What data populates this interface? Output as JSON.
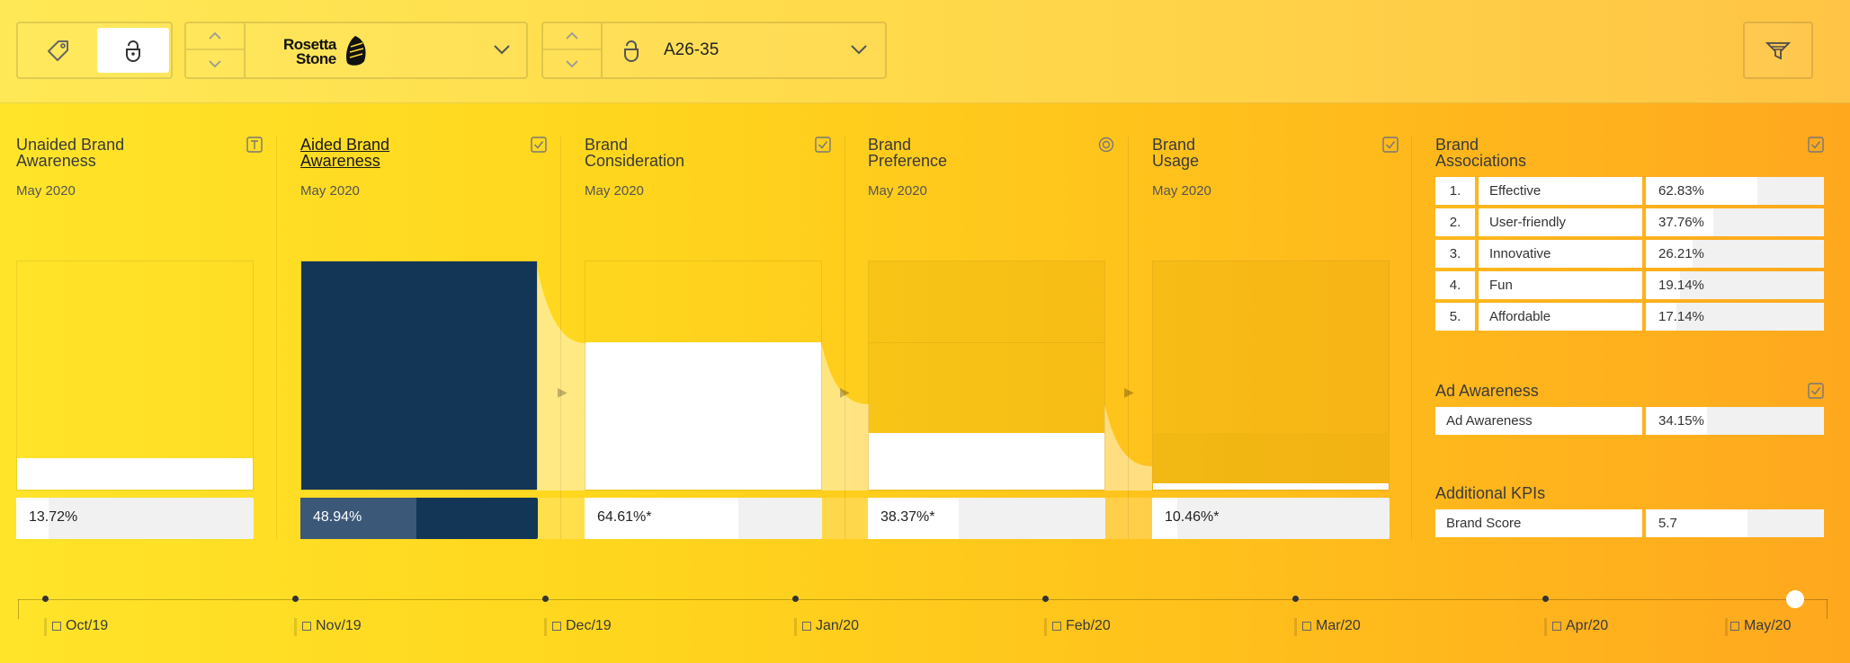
{
  "toolbar": {
    "brand": {
      "line1": "Rosetta",
      "line2": "Stone"
    },
    "age_group": "A26-35"
  },
  "kpis": [
    {
      "title_line1": "Unaided Brand",
      "title_line2": "Awareness",
      "date": "May 2020",
      "value": "13.72%",
      "pct": 13.72
    },
    {
      "title_line1": "Aided Brand",
      "title_line2": "Awareness",
      "date": "May 2020",
      "value": "48.94%",
      "pct": 48.94
    },
    {
      "title_line1": "Brand",
      "title_line2": "Consideration",
      "date": "May 2020",
      "value": "64.61%*",
      "pct": 64.61
    },
    {
      "title_line1": "Brand",
      "title_line2": "Preference",
      "date": "May 2020",
      "value": "38.37%*",
      "pct": 38.37
    },
    {
      "title_line1": "Brand",
      "title_line2": "Usage",
      "date": "May 2020",
      "value": "10.46%*",
      "pct": 10.46
    }
  ],
  "associations": {
    "title_line1": "Brand",
    "title_line2": "Associations",
    "items": [
      {
        "rank": "1.",
        "label": "Effective",
        "value": "62.83%",
        "pct": 62.83
      },
      {
        "rank": "2.",
        "label": "User-friendly",
        "value": "37.76%",
        "pct": 37.76
      },
      {
        "rank": "3.",
        "label": "Innovative",
        "value": "26.21%",
        "pct": 26.21
      },
      {
        "rank": "4.",
        "label": "Fun",
        "value": "19.14%",
        "pct": 19.14
      },
      {
        "rank": "5.",
        "label": "Affordable",
        "value": "17.14%",
        "pct": 17.14
      }
    ]
  },
  "ad_awareness": {
    "title": "Ad Awareness",
    "label": "Ad Awareness",
    "value": "34.15%",
    "pct": 34.15
  },
  "additional_kpis": {
    "title": "Additional KPIs",
    "label": "Brand Score",
    "value": "5.7",
    "pct": 57
  },
  "timeline": {
    "months": [
      "Oct/19",
      "Nov/19",
      "Dec/19",
      "Jan/20",
      "Feb/20",
      "Mar/20",
      "Apr/20",
      "May/20"
    ],
    "selected": "May/20"
  },
  "colors": {
    "accent_navy": "#133657",
    "background_start": "#ffe42a",
    "background_end": "#ffa81e"
  }
}
